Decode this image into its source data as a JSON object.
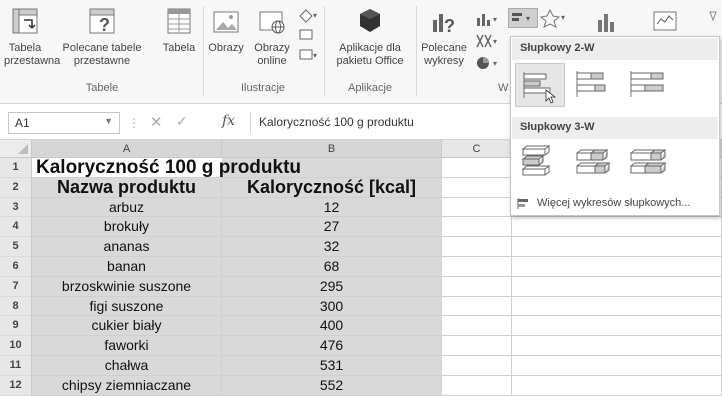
{
  "ribbon": {
    "buttons": [
      {
        "label": "Tabela przestawna"
      },
      {
        "label": "Polecane tabele przestawne"
      },
      {
        "label": "Tabela"
      },
      {
        "label": "Obrazy"
      },
      {
        "label": "Obrazy online"
      },
      {
        "label": "Aplikacje dla pakietu Office"
      },
      {
        "label": "Polecane wykresy"
      }
    ],
    "groups": [
      {
        "label": "Tabele"
      },
      {
        "label": "Ilustracje"
      },
      {
        "label": "Aplikacje"
      },
      {
        "label": "W"
      }
    ]
  },
  "formula_bar": {
    "name_box": "A1",
    "fx": "fx",
    "content": "Kaloryczność 100 g produktu"
  },
  "grid": {
    "columns": [
      "A",
      "B",
      "C"
    ],
    "rows": [
      {
        "num": "1",
        "a": "Kaloryczność 100 g produktu",
        "b": ""
      },
      {
        "num": "2",
        "a": "Nazwa produktu",
        "b": "Kaloryczność [kcal]"
      },
      {
        "num": "3",
        "a": "arbuz",
        "b": "12"
      },
      {
        "num": "4",
        "a": "brokuły",
        "b": "27"
      },
      {
        "num": "5",
        "a": "ananas",
        "b": "32"
      },
      {
        "num": "6",
        "a": "banan",
        "b": "68"
      },
      {
        "num": "7",
        "a": "brzoskwinie suszone",
        "b": "295"
      },
      {
        "num": "8",
        "a": "figi suszone",
        "b": "300"
      },
      {
        "num": "9",
        "a": "cukier biały",
        "b": "400"
      },
      {
        "num": "10",
        "a": "faworki",
        "b": "476"
      },
      {
        "num": "11",
        "a": "chałwa",
        "b": "531"
      },
      {
        "num": "12",
        "a": "chipsy ziemniaczane",
        "b": "552"
      }
    ]
  },
  "dropdown": {
    "section1": "Słupkowy 2-W",
    "section2": "Słupkowy 3-W",
    "more": "Więcej wykresów słupkowych..."
  }
}
